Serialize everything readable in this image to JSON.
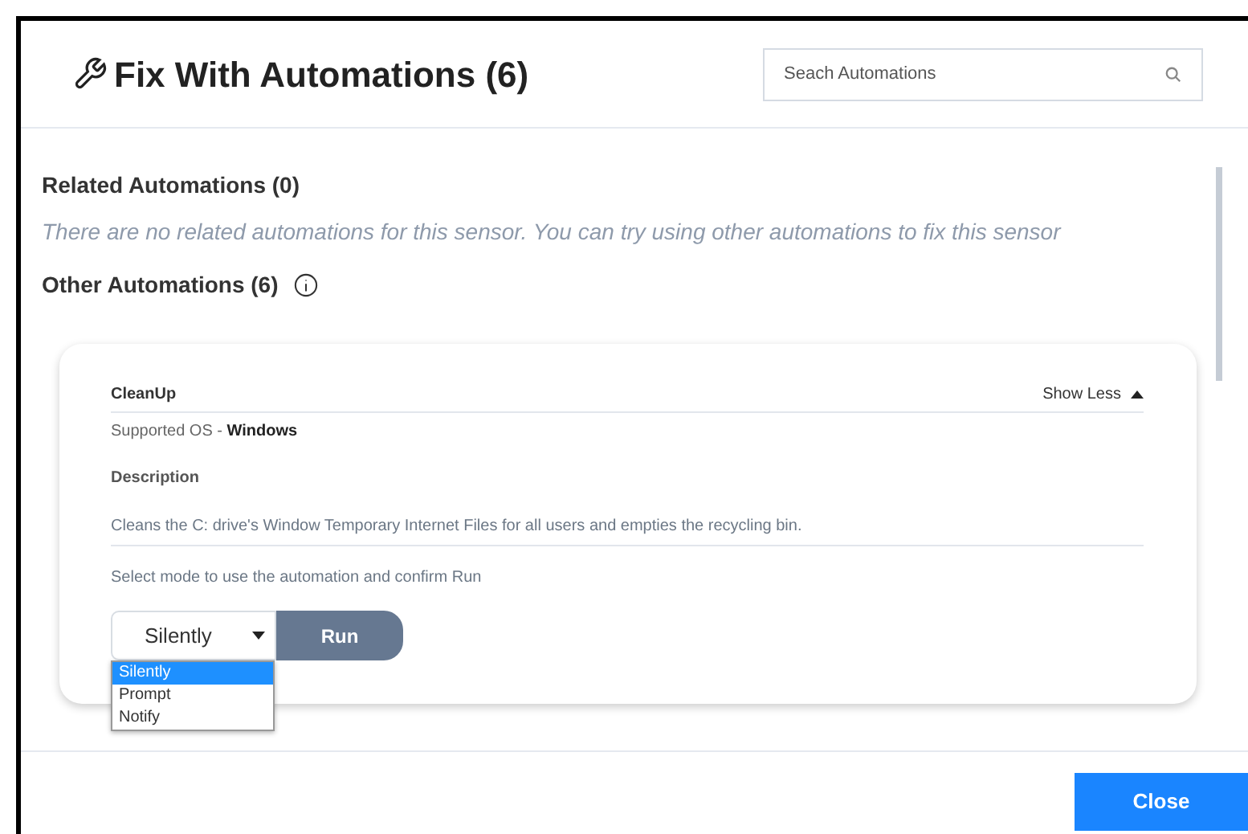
{
  "dialog": {
    "title": "Fix With Automations (6)",
    "search": {
      "placeholder": "Seach Automations"
    }
  },
  "related": {
    "heading": "Related Automations (0)",
    "empty_message": "There are no related automations for this sensor. You can try using other automations to fix this sensor"
  },
  "other": {
    "heading": "Other Automations (6)"
  },
  "automation": {
    "name": "CleanUp",
    "toggle": "Show Less",
    "expanded": true,
    "os_label": "Supported OS - ",
    "os_value": "Windows",
    "description_label": "Description",
    "description": "Cleans the C: drive's Window Temporary Internet Files for all users and empties the recycling bin.",
    "mode_hint": "Select mode to use the automation and confirm Run",
    "mode_value": "Silently",
    "run": "Run",
    "mode_options": [
      {
        "label": "Silently",
        "selected": true
      },
      {
        "label": "Prompt",
        "selected": false
      },
      {
        "label": "Notify",
        "selected": false
      }
    ]
  },
  "footer": {
    "close": "Close"
  }
}
